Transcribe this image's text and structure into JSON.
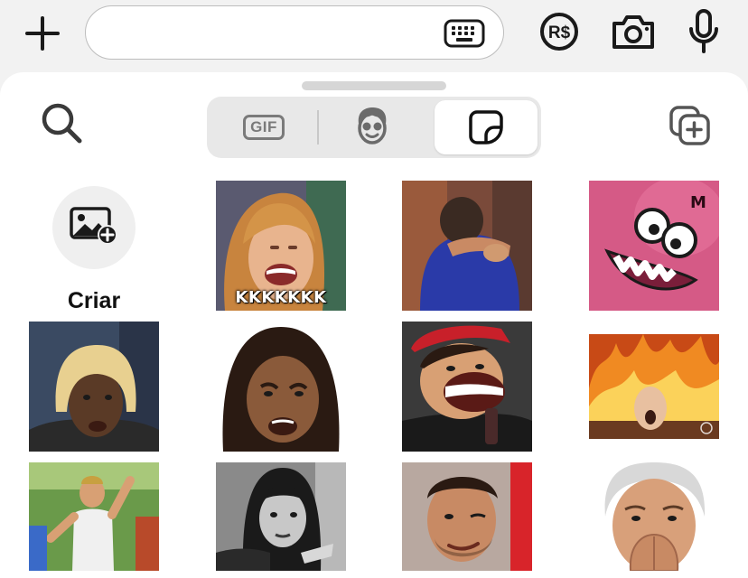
{
  "composer": {
    "plus_icon": "plus-icon",
    "input_value": "",
    "keyboard_icon": "keyboard-icon",
    "currency_badge": "R$",
    "camera_icon": "camera-icon",
    "mic_icon": "microphone-icon"
  },
  "picker": {
    "tabs": [
      {
        "label": "GIF",
        "icon": "gif-icon",
        "selected": false
      },
      {
        "label": "",
        "icon": "avatar-face-icon",
        "selected": false
      },
      {
        "label": "",
        "icon": "sticker-icon",
        "selected": true
      }
    ],
    "create_label": "Criar",
    "stickers": [
      {
        "caption": "KKKKKKK"
      },
      {
        "caption": ""
      },
      {
        "caption": ""
      },
      {
        "caption": ""
      },
      {
        "caption": ""
      },
      {
        "caption": ""
      },
      {
        "caption": ""
      },
      {
        "caption": ""
      },
      {
        "caption": ""
      },
      {
        "caption": ""
      },
      {
        "caption": ""
      }
    ]
  },
  "colors": {
    "background": "#f2f2f2",
    "panel": "#ffffff",
    "icon_dark": "#1a1a1a",
    "segment_bg": "#e8e8e8"
  }
}
